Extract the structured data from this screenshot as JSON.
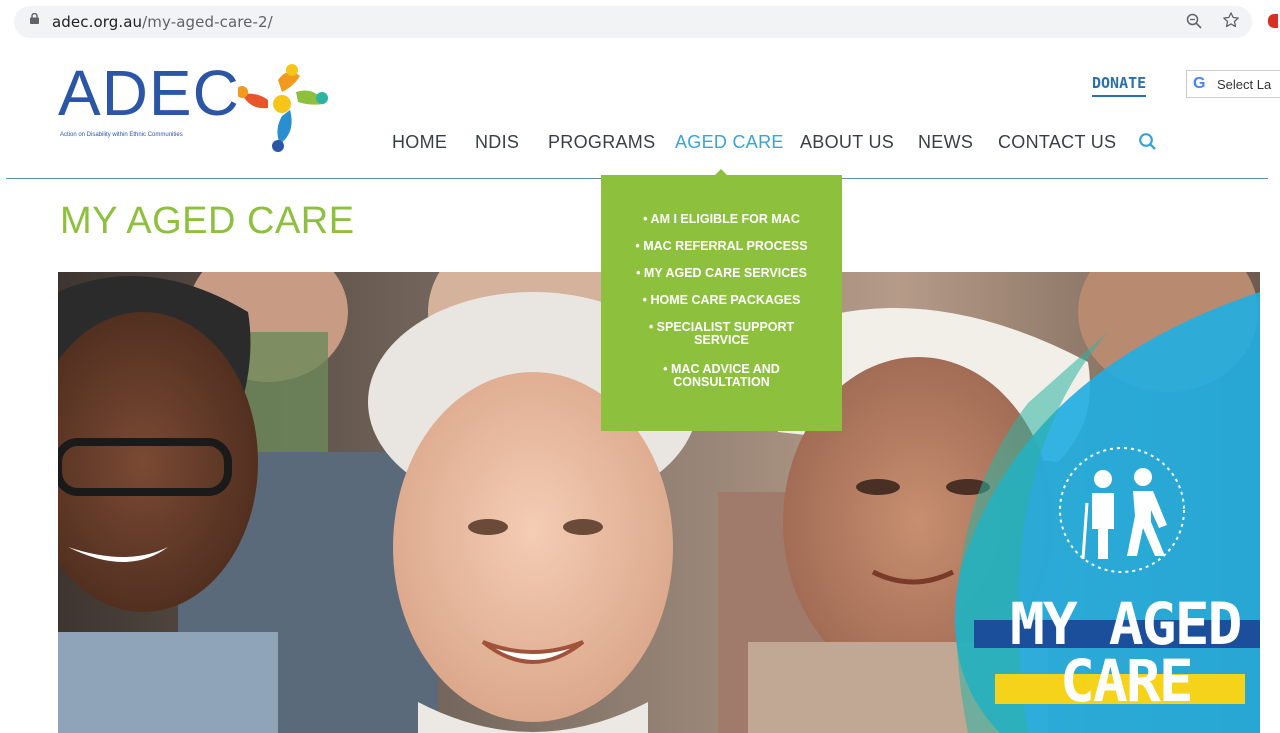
{
  "browser": {
    "url_host": "adec.org.au",
    "url_path": "/my-aged-care-2/"
  },
  "header": {
    "logo_text": "ADEC",
    "logo_tagline": "Action on Disability within Ethnic Communities",
    "donate_label": "DONATE",
    "translate_label": "Select La"
  },
  "nav": {
    "items": [
      "HOME",
      "NDIS",
      "PROGRAMS",
      "AGED CARE",
      "ABOUT US",
      "NEWS",
      "CONTACT US"
    ],
    "active": "AGED CARE"
  },
  "dropdown": {
    "items": [
      "• AM I ELIGIBLE FOR MAC",
      "• MAC REFERRAL PROCESS",
      "• MY AGED CARE SERVICES",
      "• HOME CARE PACKAGES",
      "• SPECIALIST SUPPORT SERVICE",
      "• MAC ADVICE AND CONSULTATION"
    ]
  },
  "main": {
    "page_title": "MY AGED CARE",
    "banner_line1": "MY AGED",
    "banner_line2": "CARE"
  },
  "colors": {
    "accent_green": "#8dc03d",
    "nav_active": "#3aa3d8",
    "logo_blue": "#2b56a6"
  },
  "icons": [
    "lock-icon",
    "zoom-icon",
    "star-icon",
    "search-icon",
    "google-translate-icon",
    "elderly-people-icon"
  ]
}
